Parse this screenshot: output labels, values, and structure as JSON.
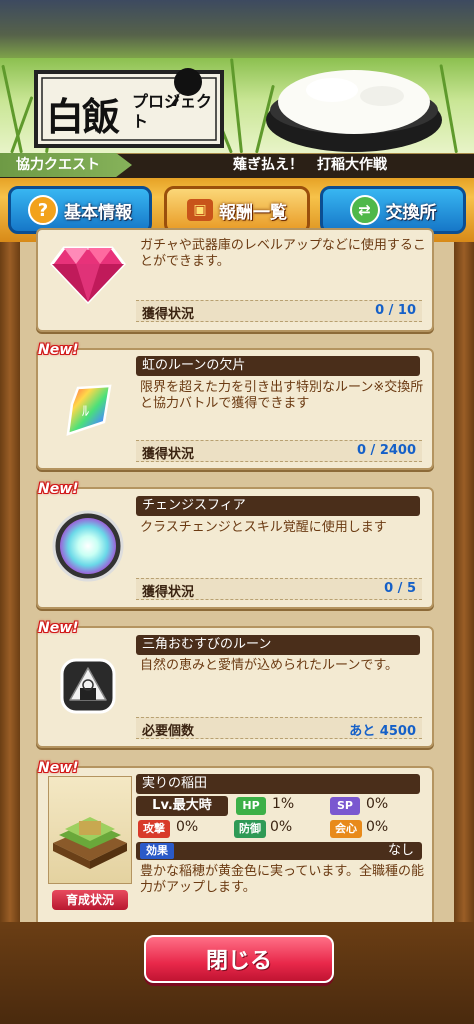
{
  "header": {
    "logo_main": "白飯",
    "logo_sub": "プロジェクト",
    "quest_category": "協力クエスト",
    "quest_title": "薙ぎ払え！　打稲大作戦"
  },
  "tabs": [
    {
      "label": "基本情報",
      "icon": "question-icon",
      "active": false
    },
    {
      "label": "報酬一覧",
      "icon": "treasure-chest-icon",
      "active": true
    },
    {
      "label": "交換所",
      "icon": "exchange-icon",
      "active": false
    }
  ],
  "items": [
    {
      "name": "",
      "desc": "ガチャや武器庫のレベルアップなどに使用することができます。",
      "stat_label": "獲得状況",
      "stat_value": "0 / 10",
      "icon": "diamond-gem-icon",
      "new": false
    },
    {
      "name": "虹のルーンの欠片",
      "desc": "限界を超えた力を引き出す特別なルーン※交換所と協力バトルで獲得できます",
      "stat_label": "獲得状況",
      "stat_value": "0 / 2400",
      "icon": "rainbow-rune-shard-icon",
      "new": true,
      "new_label": "New!"
    },
    {
      "name": "チェンジスフィア",
      "desc": "クラスチェンジとスキル覚醒に使用します",
      "stat_label": "獲得状況",
      "stat_value": "0 / 5",
      "icon": "change-sphere-icon",
      "new": true,
      "new_label": "New!"
    },
    {
      "name": "三角おむすびのルーン",
      "desc": "自然の恵みと愛情が込められたルーンです。",
      "stat_label": "必要個数",
      "stat_value": "あと 4500",
      "icon": "onigiri-rune-icon",
      "new": true,
      "new_label": "New!"
    }
  ],
  "facility": {
    "name": "実りの稲田",
    "new_label": "New!",
    "level": "Lv.最大時",
    "hp_label": "HP",
    "hp_value": "1%",
    "sp_label": "SP",
    "sp_value": "0%",
    "atk_label": "攻撃",
    "atk_value": "0%",
    "def_label": "防御",
    "def_value": "0%",
    "crit_label": "会心",
    "crit_value": "0%",
    "effect_label": "効果",
    "effect_value": "なし",
    "desc": "豊かな稲穂が黄金色に実っています。全職種の能力がアップします。",
    "grow_button": "育成状況",
    "icon": "rice-field-icon"
  },
  "close_button": "閉じる",
  "colors": {
    "accent_orange": "#f6c24a",
    "tab_blue": "#1677c8",
    "close_red": "#e8284a",
    "stat_blue": "#1560c8"
  }
}
